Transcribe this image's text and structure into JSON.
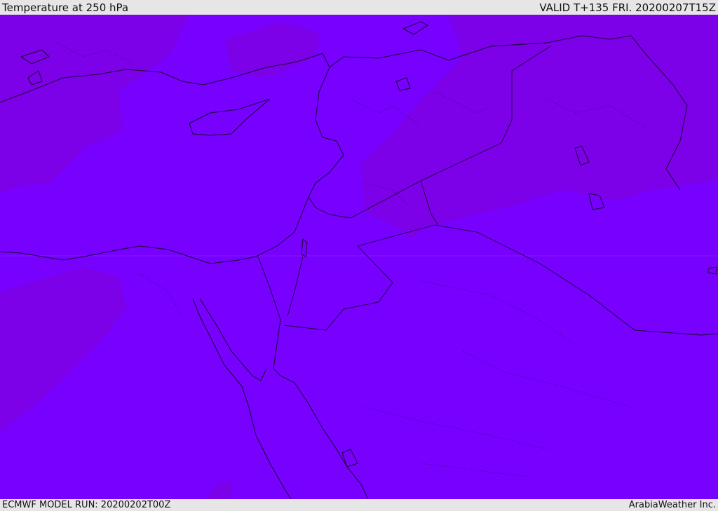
{
  "header": {
    "title": "Temperature at 250 hPa",
    "valid": "VALID T+135 FRI. 20200207T15Z"
  },
  "footer": {
    "model_run": "ECMWF MODEL RUN: 20200202T00Z",
    "credit": "ArabiaWeather Inc."
  },
  "colors": {
    "field_main": "#7700ff",
    "field_cold": "#7c00e8",
    "border": "#1a0033"
  }
}
